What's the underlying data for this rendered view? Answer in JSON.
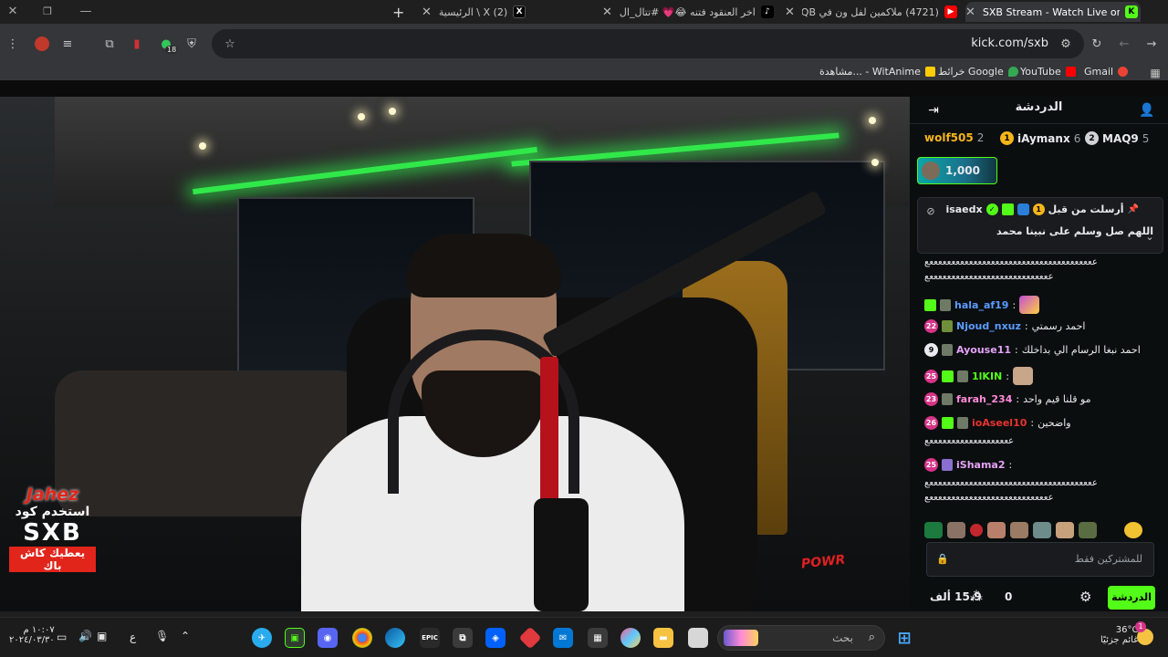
{
  "browser": {
    "tabs": [
      {
        "title": "SXB Stream - Watch Live on",
        "favicon": "kick",
        "color": "#53fc18",
        "active": true
      },
      {
        "title": "(4721) ملاكمين لفل ون في IQB",
        "favicon": "youtube",
        "color": "#ff0000",
        "active": false
      },
      {
        "title": "اخر العنقود فتنه 😂💗 #تتال_ال",
        "favicon": "tiktok",
        "color": "#000000",
        "active": false
      },
      {
        "title": "(2) X \\ الرئيسية",
        "favicon": "x",
        "color": "#000000",
        "active": false
      }
    ],
    "new_tab": "+",
    "url": "kick.com/sxb",
    "extension_count": "18",
    "bookmarks": [
      {
        "label": "Gmail",
        "color": "#ea4335"
      },
      {
        "label": "YouTube",
        "color": "#ff0000"
      },
      {
        "label": "خرائط Google",
        "color": "#34a853"
      },
      {
        "label": "مشاهدة... - WitAnime",
        "color": "#ffcc00"
      }
    ]
  },
  "stream": {
    "overlay": {
      "brand": "Jahez",
      "line1": "استخدم كود",
      "code": "SXB",
      "line2": "يعطيك كاش باك"
    },
    "signature": "POWR"
  },
  "chat": {
    "title": "الدردشة",
    "gifters": [
      {
        "name": "MAQ9",
        "count": "5",
        "rank": "2",
        "rank_color": "#cfd3d6"
      },
      {
        "name": "iAymanx",
        "count": "6",
        "rank": "1",
        "rank_color": "#f5b51b"
      },
      {
        "name": "wolf505",
        "count": "2",
        "rank": "",
        "rank_color": ""
      }
    ],
    "goal": {
      "value": "1,000"
    },
    "pinned": {
      "user": "isaedx",
      "sent_by": "أرسلت من قبل",
      "message": "اللهم صل وسلم على نبينا محمد"
    },
    "messages": [
      {
        "type": "long",
        "text": "ععععععععععععععععععععععععععععععععععععععع"
      },
      {
        "type": "long",
        "text": "ععععععععععععععععععععععععععععع"
      },
      {
        "user": "hala_af19",
        "color": "#5b9bff",
        "text": "",
        "sub": "",
        "emote": "#c44fd3"
      },
      {
        "user": "Njoud_nxuz",
        "color": "#5b9bff",
        "text": "احمد رسمتي",
        "sub": "22",
        "emote": ""
      },
      {
        "user": "Ayouse11",
        "color": "#e4a3f7",
        "text": "احمد نبغا الرسام الي بداخلك",
        "sub": "9",
        "emote": ""
      },
      {
        "user": "1lKIN",
        "color": "#53fc18",
        "text": "",
        "sub": "25",
        "emote": "#c8a68a"
      },
      {
        "user": "farah_234",
        "color": "#ff8ad8",
        "text": "مو قلنا قيم واحد",
        "sub": "23",
        "emote": ""
      },
      {
        "user": "ioAseel10",
        "color": "#e8332f",
        "text": "واضحين",
        "sub": "26",
        "emote": ""
      },
      {
        "type": "long",
        "text": "عععععععععععععععععععع"
      },
      {
        "user": "iShama2",
        "color": "#e4a3f7",
        "text": "",
        "sub": "25",
        "emote": ""
      },
      {
        "type": "long",
        "text": "ععععععععععععععععععععععععععععععععععععععع"
      },
      {
        "type": "long",
        "text": "ععععععععععععععععععععععععععععع"
      }
    ],
    "input_placeholder": "للمشتركين فقط",
    "viewers": "15.9 ألف",
    "zero": "0",
    "send_label": "الدردشة"
  },
  "taskbar": {
    "search_placeholder": "بحث",
    "weather_temp": "36°C",
    "weather_desc": "غائم جزئيًا",
    "time": "١٠:٠٧ م",
    "date": "٢٠٢٤/٠٣/٣٠",
    "lang": "ع",
    "notif_count": "1"
  }
}
